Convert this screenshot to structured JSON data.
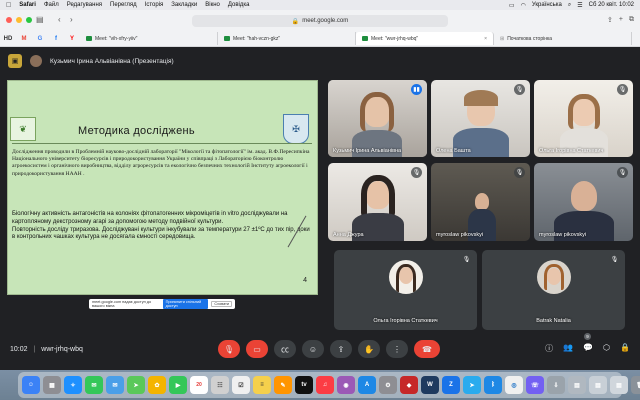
{
  "menubar": {
    "app_name": "Safari",
    "items": [
      "Файл",
      "Редагування",
      "Перегляд",
      "Історія",
      "Закладки",
      "Вікно",
      "Довідка"
    ],
    "input_source": "Українська",
    "clock": "Сб 20 квіт. 10:02"
  },
  "browser": {
    "url": "meet.google.com",
    "pinned": [
      "HD",
      "M",
      "G",
      "f",
      "Y"
    ],
    "tabs": [
      {
        "label": "Meet: \"vih-xfry-yiiv\"",
        "active": false
      },
      {
        "label": "Meet: \"hah-vczn-gkz\"",
        "active": false
      },
      {
        "label": "Meet: \"wwr-jrhq-wbq\"",
        "active": true
      },
      {
        "label": "Початкова сторінка",
        "active": false
      }
    ]
  },
  "meet": {
    "presenter_label": "Кузьмич Ірина Альвіанівна (Презентація)",
    "slide": {
      "title": "Методика досліджень",
      "paragraph1": "Дослідження проводили в Проблемній науково-дослідній лабораторії \"Мікології та фітопатології\" ім. акад. В.Ф.Пересипкіна Національного університету біоресурсів і природокористування України у співпраці з Лабораторією біоконтролю агроекосистем і органічного виробництва, відділу агроресурсів та екологічно безпечних технологій Інституту агроекології і природокористування НААН .",
      "paragraph2a": "Біологічну активність антагоністів на колоніях фітопатогенних мікроміцетів in vitro досліджували на картопляному декстрозному агарі за допомогою методу подвійної культури.",
      "paragraph2b": "Повторність досліду триразова. Досліджувані культури інкубували за температури 27 ±1ºC до тих пір, доки в контрольних чашках культура не досягала ємності середовища.",
      "page_number": "4"
    },
    "share_banner": {
      "text": "meet.google.com надає доступ до вашого вікна",
      "stop_label": "Припинити спільний доступ",
      "hide_label": "Сховати"
    },
    "participants": [
      {
        "name": "Кузьмич Ірина Альвіанівна",
        "speaking": true
      },
      {
        "name": "Олена Башта",
        "speaking": false
      },
      {
        "name": "Ольга Ігорівна Статкевич",
        "speaking": false
      },
      {
        "name": "Анна Джура",
        "speaking": false
      },
      {
        "name": "myroslaw pikovskyi",
        "speaking": false
      },
      {
        "name": "myroslaw pikovskyi",
        "speaking": false
      },
      {
        "name": "Ольга Ігорівна Статкевич",
        "speaking": false
      },
      {
        "name": "Batrak Natalia",
        "speaking": false
      }
    ],
    "meeting_time": "10:02",
    "meeting_code": "wwr-jrhq-wbq",
    "participant_badge": "9"
  },
  "colors": {
    "meet_bg": "#202124",
    "end_call": "#ea4335",
    "slide_bg": "#c7e5b8",
    "speaking": "#1a73e8"
  }
}
